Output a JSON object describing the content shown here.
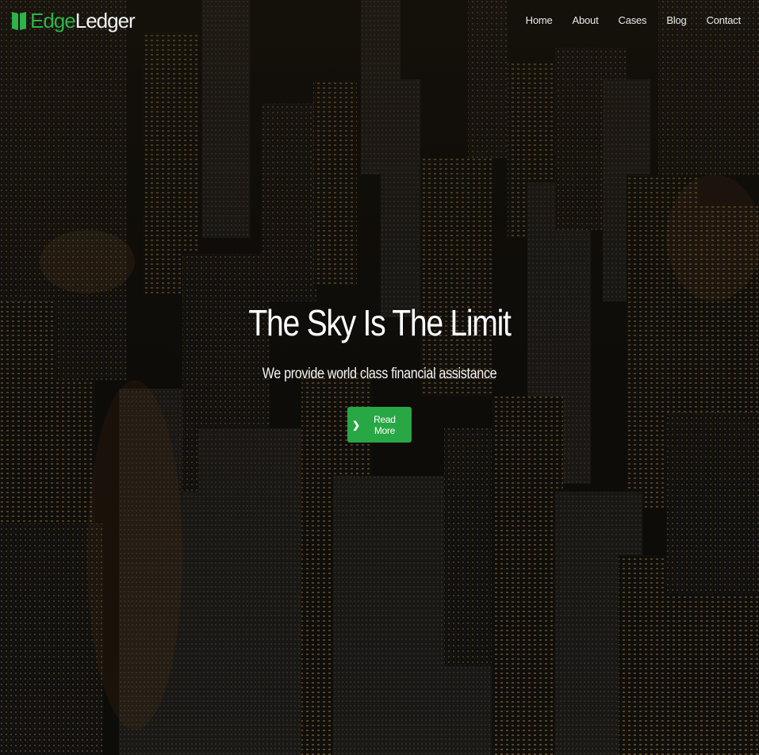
{
  "brand": {
    "edge": "Edge",
    "ledger": "Ledger",
    "icon": "book-icon",
    "color_edge": "#2db34a"
  },
  "nav": {
    "home": "Home",
    "about": "About",
    "cases": "Cases",
    "blog": "Blog",
    "contact": "Contact"
  },
  "hero": {
    "title": "The Sky Is The Limit",
    "subtitle": "We provide world class financial assistance",
    "button_label": "Read More",
    "button_icon": "chevron-right-icon",
    "button_color": "#28a745"
  }
}
